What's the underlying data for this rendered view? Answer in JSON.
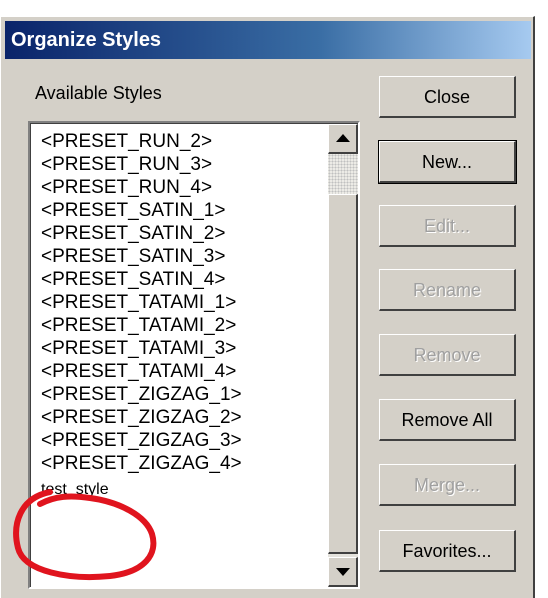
{
  "dialog": {
    "title": "Organize Styles",
    "available_label": "Available Styles"
  },
  "styles": [
    "<PRESET_RUN_2>",
    "<PRESET_RUN_3>",
    "<PRESET_RUN_4>",
    "<PRESET_SATIN_1>",
    "<PRESET_SATIN_2>",
    "<PRESET_SATIN_3>",
    "<PRESET_SATIN_4>",
    "<PRESET_TATAMI_1>",
    "<PRESET_TATAMI_2>",
    "<PRESET_TATAMI_3>",
    "<PRESET_TATAMI_4>",
    "<PRESET_ZIGZAG_1>",
    "<PRESET_ZIGZAG_2>",
    "<PRESET_ZIGZAG_3>",
    "<PRESET_ZIGZAG_4>",
    "test_style"
  ],
  "buttons": {
    "close": "Close",
    "new": "New...",
    "edit": "Edit...",
    "rename": "Rename",
    "remove": "Remove",
    "remove_all": "Remove All",
    "merge": "Merge...",
    "favorites": "Favorites..."
  },
  "colors": {
    "annotation": "#e0141e",
    "title_bar": "#0a246a"
  }
}
